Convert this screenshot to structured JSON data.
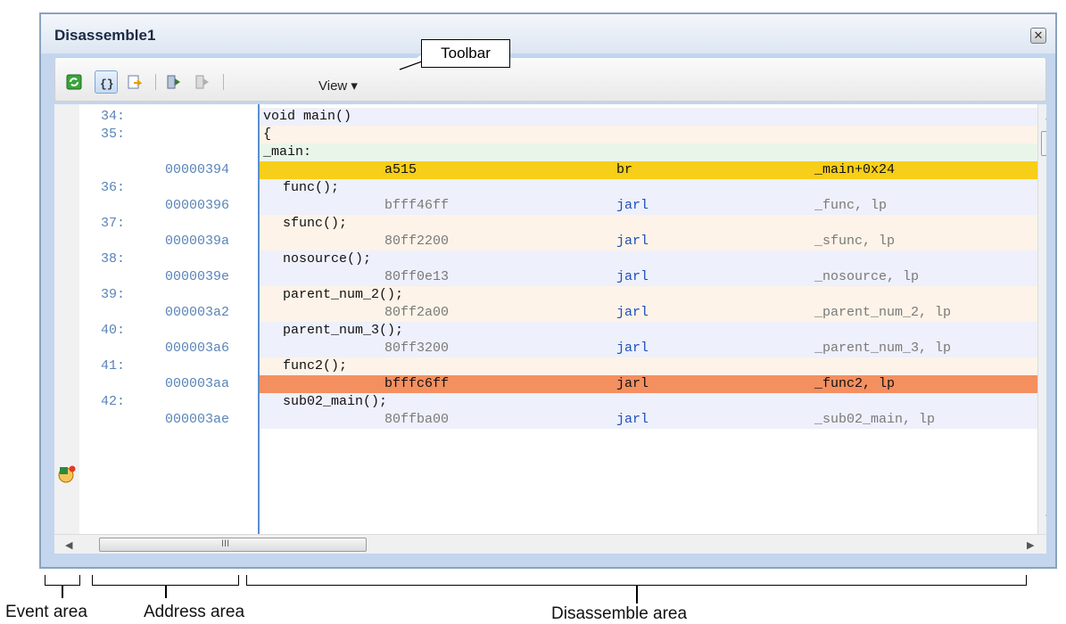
{
  "window": {
    "title": "Disassemble1",
    "close_glyph": "✕"
  },
  "toolbar": {
    "buttons": [
      {
        "name": "refresh-icon"
      },
      {
        "name": "source-view-icon"
      },
      {
        "name": "jump-to-source-icon"
      },
      {
        "name": "step-icon"
      },
      {
        "name": "step-disabled-icon"
      }
    ],
    "view_label": "View ▾"
  },
  "callout": {
    "toolbar_label": "Toolbar"
  },
  "rows": [
    {
      "type": "src",
      "lineno": "34:",
      "text": "void main()"
    },
    {
      "type": "src",
      "lineno": "35:",
      "text": "{"
    },
    {
      "type": "label",
      "text": "_main:"
    },
    {
      "type": "instr",
      "addr": "00000394",
      "code": "a515",
      "mnem": "br",
      "oper": "_main+0x24",
      "highlight": "current-pc"
    },
    {
      "type": "src",
      "lineno": "36:",
      "text": "func();"
    },
    {
      "type": "instr",
      "addr": "00000396",
      "code": "bfff46ff",
      "mnem": "jarl",
      "oper": "_func, lp"
    },
    {
      "type": "src",
      "lineno": "37:",
      "text": "sfunc();"
    },
    {
      "type": "instr",
      "addr": "0000039a",
      "code": "80ff2200",
      "mnem": "jarl",
      "oper": "_sfunc, lp"
    },
    {
      "type": "src",
      "lineno": "38:",
      "text": "nosource();"
    },
    {
      "type": "instr",
      "addr": "0000039e",
      "code": "80ff0e13",
      "mnem": "jarl",
      "oper": "_nosource, lp"
    },
    {
      "type": "src",
      "lineno": "39:",
      "text": "parent_num_2();"
    },
    {
      "type": "instr",
      "addr": "000003a2",
      "code": "80ff2a00",
      "mnem": "jarl",
      "oper": "_parent_num_2, lp"
    },
    {
      "type": "src",
      "lineno": "40:",
      "text": "parent_num_3();"
    },
    {
      "type": "instr",
      "addr": "000003a6",
      "code": "80ff3200",
      "mnem": "jarl",
      "oper": "_parent_num_3, lp"
    },
    {
      "type": "src",
      "lineno": "41:",
      "text": "func2();"
    },
    {
      "type": "instr",
      "addr": "000003aa",
      "code": "bfffc6ff",
      "mnem": "jarl",
      "oper": "_func2, lp",
      "highlight": "event"
    },
    {
      "type": "src",
      "lineno": "42:",
      "text": "sub02_main();"
    },
    {
      "type": "instr",
      "addr": "000003ae",
      "code": "80ffba00",
      "mnem": "jarl",
      "oper": "_sub02_main, lp"
    }
  ],
  "scrollbar": {
    "h_thumb_grip": "III",
    "up": "▲",
    "down": "▼",
    "left": "◀",
    "right": "▶"
  },
  "annotations": {
    "event_area": "Event area",
    "address_area": "Address area",
    "disassemble_area": "Disassemble area"
  },
  "colors": {
    "current_pc": "#f7ce19",
    "event_highlight": "#f48f60",
    "address_text": "#5a84b8",
    "mnemonic_text": "#1f4fb8"
  }
}
